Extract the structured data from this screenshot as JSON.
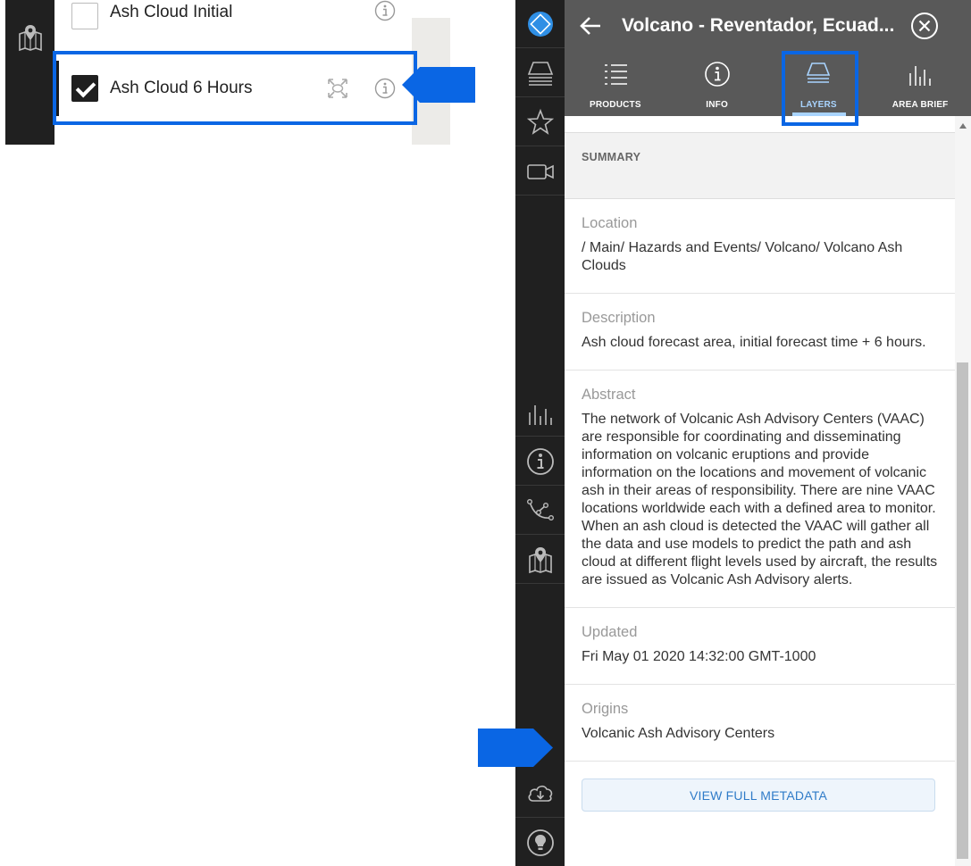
{
  "inset": {
    "layers": [
      {
        "label": "Ash Cloud Initial",
        "checked": false
      },
      {
        "label": "Ash Cloud 6 Hours",
        "checked": true
      }
    ]
  },
  "header": {
    "title": "Volcano - Reventador, Ecuad...",
    "back_icon": "arrow-left-icon",
    "close_icon": "close-circle-icon"
  },
  "tabs": [
    {
      "label": "PRODUCTS",
      "icon": "list-icon",
      "active": false
    },
    {
      "label": "INFO",
      "icon": "info-icon",
      "active": false
    },
    {
      "label": "LAYERS",
      "icon": "layers-icon",
      "active": true
    },
    {
      "label": "AREA BRIEF",
      "icon": "bar-chart-icon",
      "active": false
    }
  ],
  "summary": {
    "heading": "SUMMARY",
    "sections": [
      {
        "label": "Location",
        "value": "/ Main/ Hazards and Events/ Volcano/ Volcano Ash Clouds"
      },
      {
        "label": "Description",
        "value": "Ash cloud forecast area, initial forecast time + 6 hours."
      },
      {
        "label": "Abstract",
        "value": "The network of Volcanic Ash Advisory Centers (VAAC) are responsible for coordinating and disseminating information on volcanic eruptions and provide information on the locations and movement of volcanic ash in their areas of responsibility. There are nine VAAC locations worldwide each with a defined area to monitor. When an ash cloud is detected the VAAC will gather all the data and use models to predict the path and ash cloud at different flight levels used by aircraft, the results are issued as Volcanic Ash Advisory alerts."
      },
      {
        "label": "Updated",
        "value": "Fri May 01 2020 14:32:00 GMT-1000"
      },
      {
        "label": "Origins",
        "value": "Volcanic Ash Advisory Centers"
      }
    ],
    "button_label": "VIEW FULL METADATA"
  },
  "rail_icons": [
    "logo-diamond-icon",
    "layers-icon",
    "star-icon",
    "video-icon",
    "bar-chart-icon",
    "info-icon",
    "path-tool-icon",
    "map-icon",
    "cloud-download-icon",
    "lightbulb-icon"
  ],
  "colors": {
    "rail": "#202020",
    "header": "#595959",
    "highlight": "#0a66e4",
    "active_tab": "#a9d4ff",
    "logo": "#2f8fe5"
  }
}
